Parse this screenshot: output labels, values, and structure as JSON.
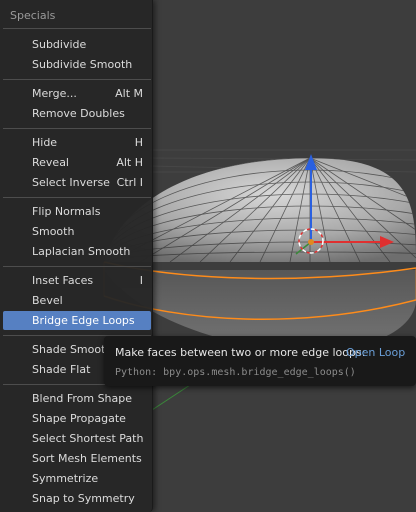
{
  "menu": {
    "title": "Specials",
    "items": [
      {
        "label": "Subdivide",
        "shortcut": ""
      },
      {
        "label": "Subdivide Smooth",
        "shortcut": ""
      },
      {
        "label": "Merge...",
        "shortcut": "Alt M"
      },
      {
        "label": "Remove Doubles",
        "shortcut": ""
      },
      {
        "label": "Hide",
        "shortcut": "H"
      },
      {
        "label": "Reveal",
        "shortcut": "Alt H"
      },
      {
        "label": "Select Inverse",
        "shortcut": "Ctrl I"
      },
      {
        "label": "Flip Normals",
        "shortcut": ""
      },
      {
        "label": "Smooth",
        "shortcut": ""
      },
      {
        "label": "Laplacian Smooth",
        "shortcut": ""
      },
      {
        "label": "Inset Faces",
        "shortcut": "I"
      },
      {
        "label": "Bevel",
        "shortcut": ""
      },
      {
        "label": "Bridge Edge Loops",
        "shortcut": ""
      },
      {
        "label": "Shade Smooth",
        "shortcut": ""
      },
      {
        "label": "Shade Flat",
        "shortcut": ""
      },
      {
        "label": "Blend From Shape",
        "shortcut": ""
      },
      {
        "label": "Shape Propagate",
        "shortcut": ""
      },
      {
        "label": "Select Shortest Path",
        "shortcut": ""
      },
      {
        "label": "Sort Mesh Elements",
        "shortcut": ""
      },
      {
        "label": "Symmetrize",
        "shortcut": ""
      },
      {
        "label": "Snap to Symmetry",
        "shortcut": ""
      }
    ],
    "active_item": "Bridge Edge Loops"
  },
  "tooltip": {
    "description": "Make faces between two or more edge loops:",
    "value": "Open Loop",
    "python": "Python: bpy.ops.mesh.bridge_edge_loops()"
  },
  "colors": {
    "menu_bg": "#262626",
    "highlight": "#5680c2",
    "selected_edge": "#ff8c1a",
    "axis_x": "#e03030",
    "axis_z": "#2a60e0",
    "axis_y": "#3a8a3a"
  },
  "viewport": {
    "icons": [
      "transform-gizmo-z-arrow",
      "transform-gizmo-x-arrow",
      "3d-cursor",
      "y-axis-line"
    ]
  }
}
